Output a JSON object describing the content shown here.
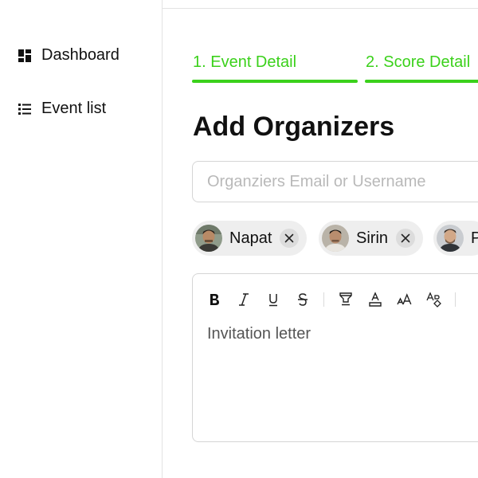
{
  "sidebar": {
    "items": [
      {
        "label": "Dashboard",
        "icon": "dashboard-icon"
      },
      {
        "label": "Event list",
        "icon": "list-icon"
      }
    ]
  },
  "steps": [
    {
      "label": "1. Event Detail"
    },
    {
      "label": "2. Score Detail"
    }
  ],
  "page": {
    "title": "Add Organizers"
  },
  "search": {
    "placeholder": "Organziers Email or Username",
    "value": ""
  },
  "organizers": [
    {
      "name": "Napat"
    },
    {
      "name": "Sirin"
    },
    {
      "name": "P"
    }
  ],
  "editor": {
    "toolbar": [
      "bold-icon",
      "italic-icon",
      "underline-icon",
      "strikethrough-icon",
      "highlight-icon",
      "text-color-icon",
      "font-size-icon",
      "clear-format-icon"
    ],
    "placeholder": "Invitation letter"
  },
  "colors": {
    "accent": "#3bd11b",
    "border": "#d5d5d5",
    "chip": "#eeeeee"
  }
}
